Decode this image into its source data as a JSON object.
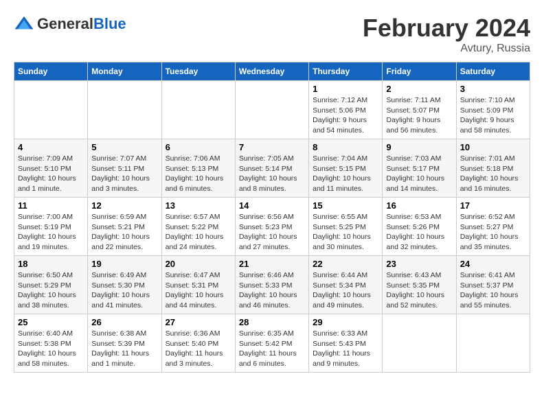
{
  "header": {
    "logo_general": "General",
    "logo_blue": "Blue",
    "month": "February 2024",
    "location": "Avtury, Russia"
  },
  "weekdays": [
    "Sunday",
    "Monday",
    "Tuesday",
    "Wednesday",
    "Thursday",
    "Friday",
    "Saturday"
  ],
  "weeks": [
    [
      {
        "day": "",
        "info": ""
      },
      {
        "day": "",
        "info": ""
      },
      {
        "day": "",
        "info": ""
      },
      {
        "day": "",
        "info": ""
      },
      {
        "day": "1",
        "info": "Sunrise: 7:12 AM\nSunset: 5:06 PM\nDaylight: 9 hours\nand 54 minutes."
      },
      {
        "day": "2",
        "info": "Sunrise: 7:11 AM\nSunset: 5:07 PM\nDaylight: 9 hours\nand 56 minutes."
      },
      {
        "day": "3",
        "info": "Sunrise: 7:10 AM\nSunset: 5:09 PM\nDaylight: 9 hours\nand 58 minutes."
      }
    ],
    [
      {
        "day": "4",
        "info": "Sunrise: 7:09 AM\nSunset: 5:10 PM\nDaylight: 10 hours\nand 1 minute."
      },
      {
        "day": "5",
        "info": "Sunrise: 7:07 AM\nSunset: 5:11 PM\nDaylight: 10 hours\nand 3 minutes."
      },
      {
        "day": "6",
        "info": "Sunrise: 7:06 AM\nSunset: 5:13 PM\nDaylight: 10 hours\nand 6 minutes."
      },
      {
        "day": "7",
        "info": "Sunrise: 7:05 AM\nSunset: 5:14 PM\nDaylight: 10 hours\nand 8 minutes."
      },
      {
        "day": "8",
        "info": "Sunrise: 7:04 AM\nSunset: 5:15 PM\nDaylight: 10 hours\nand 11 minutes."
      },
      {
        "day": "9",
        "info": "Sunrise: 7:03 AM\nSunset: 5:17 PM\nDaylight: 10 hours\nand 14 minutes."
      },
      {
        "day": "10",
        "info": "Sunrise: 7:01 AM\nSunset: 5:18 PM\nDaylight: 10 hours\nand 16 minutes."
      }
    ],
    [
      {
        "day": "11",
        "info": "Sunrise: 7:00 AM\nSunset: 5:19 PM\nDaylight: 10 hours\nand 19 minutes."
      },
      {
        "day": "12",
        "info": "Sunrise: 6:59 AM\nSunset: 5:21 PM\nDaylight: 10 hours\nand 22 minutes."
      },
      {
        "day": "13",
        "info": "Sunrise: 6:57 AM\nSunset: 5:22 PM\nDaylight: 10 hours\nand 24 minutes."
      },
      {
        "day": "14",
        "info": "Sunrise: 6:56 AM\nSunset: 5:23 PM\nDaylight: 10 hours\nand 27 minutes."
      },
      {
        "day": "15",
        "info": "Sunrise: 6:55 AM\nSunset: 5:25 PM\nDaylight: 10 hours\nand 30 minutes."
      },
      {
        "day": "16",
        "info": "Sunrise: 6:53 AM\nSunset: 5:26 PM\nDaylight: 10 hours\nand 32 minutes."
      },
      {
        "day": "17",
        "info": "Sunrise: 6:52 AM\nSunset: 5:27 PM\nDaylight: 10 hours\nand 35 minutes."
      }
    ],
    [
      {
        "day": "18",
        "info": "Sunrise: 6:50 AM\nSunset: 5:29 PM\nDaylight: 10 hours\nand 38 minutes."
      },
      {
        "day": "19",
        "info": "Sunrise: 6:49 AM\nSunset: 5:30 PM\nDaylight: 10 hours\nand 41 minutes."
      },
      {
        "day": "20",
        "info": "Sunrise: 6:47 AM\nSunset: 5:31 PM\nDaylight: 10 hours\nand 44 minutes."
      },
      {
        "day": "21",
        "info": "Sunrise: 6:46 AM\nSunset: 5:33 PM\nDaylight: 10 hours\nand 46 minutes."
      },
      {
        "day": "22",
        "info": "Sunrise: 6:44 AM\nSunset: 5:34 PM\nDaylight: 10 hours\nand 49 minutes."
      },
      {
        "day": "23",
        "info": "Sunrise: 6:43 AM\nSunset: 5:35 PM\nDaylight: 10 hours\nand 52 minutes."
      },
      {
        "day": "24",
        "info": "Sunrise: 6:41 AM\nSunset: 5:37 PM\nDaylight: 10 hours\nand 55 minutes."
      }
    ],
    [
      {
        "day": "25",
        "info": "Sunrise: 6:40 AM\nSunset: 5:38 PM\nDaylight: 10 hours\nand 58 minutes."
      },
      {
        "day": "26",
        "info": "Sunrise: 6:38 AM\nSunset: 5:39 PM\nDaylight: 11 hours\nand 1 minute."
      },
      {
        "day": "27",
        "info": "Sunrise: 6:36 AM\nSunset: 5:40 PM\nDaylight: 11 hours\nand 3 minutes."
      },
      {
        "day": "28",
        "info": "Sunrise: 6:35 AM\nSunset: 5:42 PM\nDaylight: 11 hours\nand 6 minutes."
      },
      {
        "day": "29",
        "info": "Sunrise: 6:33 AM\nSunset: 5:43 PM\nDaylight: 11 hours\nand 9 minutes."
      },
      {
        "day": "",
        "info": ""
      },
      {
        "day": "",
        "info": ""
      }
    ]
  ]
}
